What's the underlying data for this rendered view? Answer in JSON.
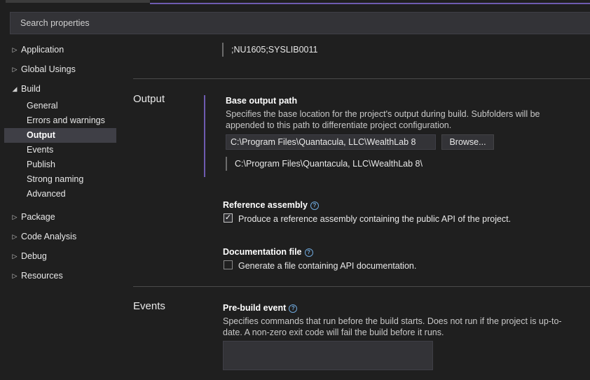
{
  "search": {
    "placeholder": "Search properties"
  },
  "sidebar": {
    "groups": {
      "application": "Application",
      "global_usings": "Global Usings",
      "build": "Build",
      "package": "Package",
      "code_analysis": "Code Analysis",
      "debug": "Debug",
      "resources": "Resources"
    },
    "build_items": [
      "General",
      "Errors and warnings",
      "Output",
      "Events",
      "Publish",
      "Strong naming",
      "Advanced"
    ],
    "selected": "Output"
  },
  "warnings_value": ";NU1605;SYSLIB0011",
  "output": {
    "title": "Output",
    "base_output_path": {
      "title": "Base output path",
      "description": "Specifies the base location for the project's output during build. Subfolders will be appended to this path to differentiate project configuration.",
      "value": "C:\\Program Files\\Quantacula, LLC\\WealthLab 8",
      "browse_label": "Browse...",
      "evaluated": "C:\\Program Files\\Quantacula, LLC\\WealthLab 8\\"
    },
    "reference_assembly": {
      "title": "Reference assembly",
      "checkbox_label": "Produce a reference assembly containing the public API of the project.",
      "checked": true
    },
    "documentation_file": {
      "title": "Documentation file",
      "checkbox_label": "Generate a file containing API documentation.",
      "checked": false
    }
  },
  "events": {
    "title": "Events",
    "pre_build": {
      "title": "Pre-build event",
      "description": "Specifies commands that run before the build starts. Does not run if the project is up-to-date. A non-zero exit code will fail the build before it runs.",
      "value": ""
    }
  },
  "icons": {
    "help": "help-circle-icon",
    "expand": "caret-right-icon",
    "collapse": "caret-down-icon",
    "check": "checkmark-icon"
  },
  "colors": {
    "accent": "#6e5bb0",
    "background": "#1f1f1f",
    "selected": "#3f3f46",
    "help": "#6fa8dc"
  }
}
